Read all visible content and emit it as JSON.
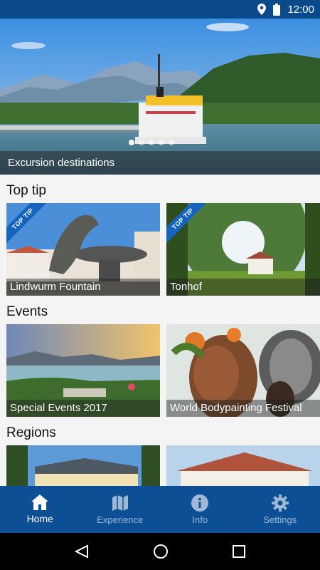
{
  "status": {
    "time": "12:00"
  },
  "hero": {
    "caption": "Excursion destinations",
    "slides": 5,
    "active_slide": 1
  },
  "sections": {
    "top_tip": {
      "title": "Top tip",
      "cards": [
        {
          "label": "Lindwurm Fountain",
          "ribbon": "TOP TIP"
        },
        {
          "label": "Tonhof",
          "ribbon": "TOP TIP"
        }
      ]
    },
    "events": {
      "title": "Events",
      "cards": [
        {
          "label": "Special Events 2017"
        },
        {
          "label": "World Bodypainting Festival"
        }
      ]
    },
    "regions": {
      "title": "Regions",
      "cards": [
        {
          "label": ""
        },
        {
          "label": ""
        }
      ]
    }
  },
  "nav": {
    "items": [
      {
        "label": "Home",
        "icon": "home-icon",
        "active": true
      },
      {
        "label": "Experience",
        "icon": "map-icon",
        "active": false
      },
      {
        "label": "Info",
        "icon": "info-icon",
        "active": false
      },
      {
        "label": "Settings",
        "icon": "gear-icon",
        "active": false
      }
    ]
  },
  "colors": {
    "primary": "#0d4f94",
    "ribbon": "#1565c0"
  }
}
